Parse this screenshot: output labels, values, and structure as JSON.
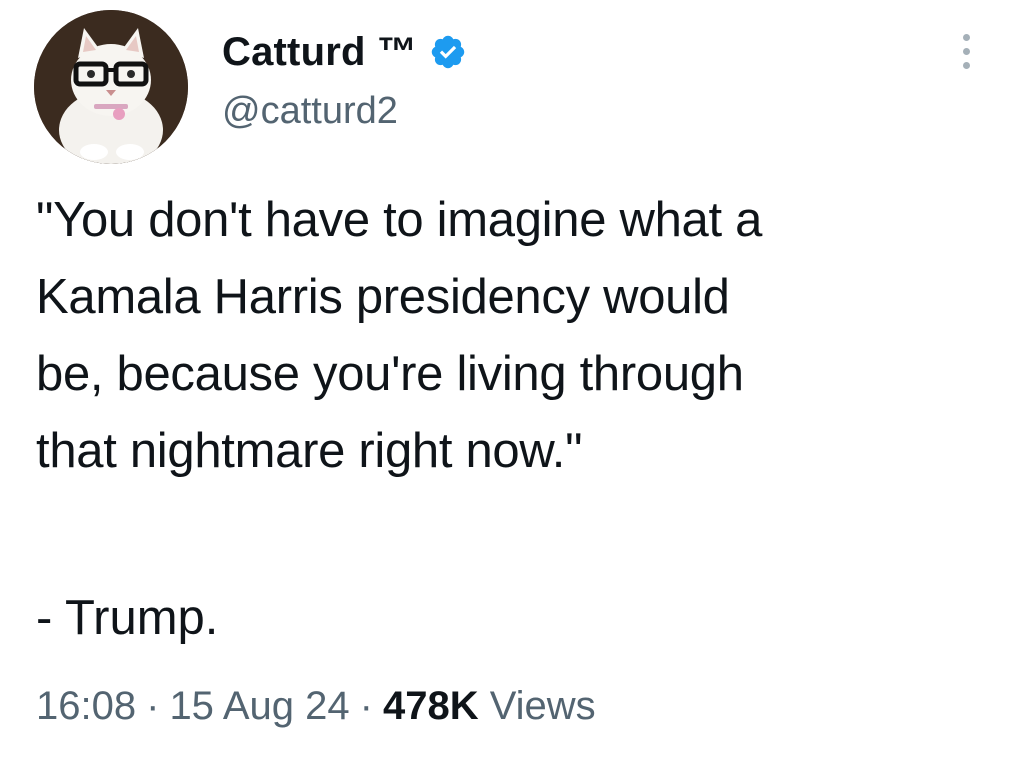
{
  "author": {
    "display_name": "Catturd ™",
    "handle": "@catturd2",
    "verified": true,
    "avatar_icon": "cat-with-glasses-avatar",
    "verified_color": "#1d9bf0"
  },
  "tweet": {
    "text": "\"You don't have to imagine what a\nKamala Harris presidency would\nbe, because you're living through\nthat nightmare right now.\"",
    "signature": "- Trump.",
    "time": "16:08",
    "separator": "·",
    "date": "15 Aug 24",
    "views_count": "478K",
    "views_label": "Views"
  },
  "menu": {
    "icon": "more-vertical-icon"
  }
}
